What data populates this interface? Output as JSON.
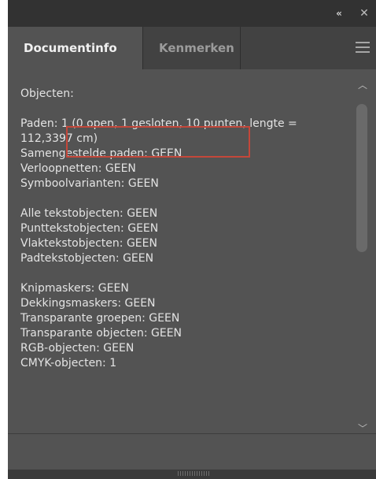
{
  "window": {
    "collapse_icon": "«",
    "close_icon": "✕"
  },
  "tabs": [
    {
      "label": "Documentinfo",
      "active": true
    },
    {
      "label": "Kenmerken",
      "active": false
    }
  ],
  "content": {
    "lines": [
      "Objecten:",
      "",
      "Paden: 1 (0 open, 1 gesloten, 10 punten, lengte = 112,3397 cm)",
      "Samengestelde paden: GEEN",
      "Verloopnetten: GEEN",
      "Symboolvarianten: GEEN",
      "",
      "Alle tekstobjecten: GEEN",
      "Punttekstobjecten: GEEN",
      "Vlaktekstobjecten: GEEN",
      "Padtekstobjecten: GEEN",
      "",
      "Knipmaskers: GEEN",
      "Dekkingsmaskers: GEEN",
      "Transparante groepen: GEEN",
      "Transparante objecten: GEEN",
      "RGB-objecten: GEEN",
      "CMYK-objecten: 1"
    ]
  },
  "colors": {
    "panel_bg": "#535353",
    "tab_bar_bg": "#424242",
    "text": "#e3e3e3",
    "highlight": "#c4473a"
  }
}
